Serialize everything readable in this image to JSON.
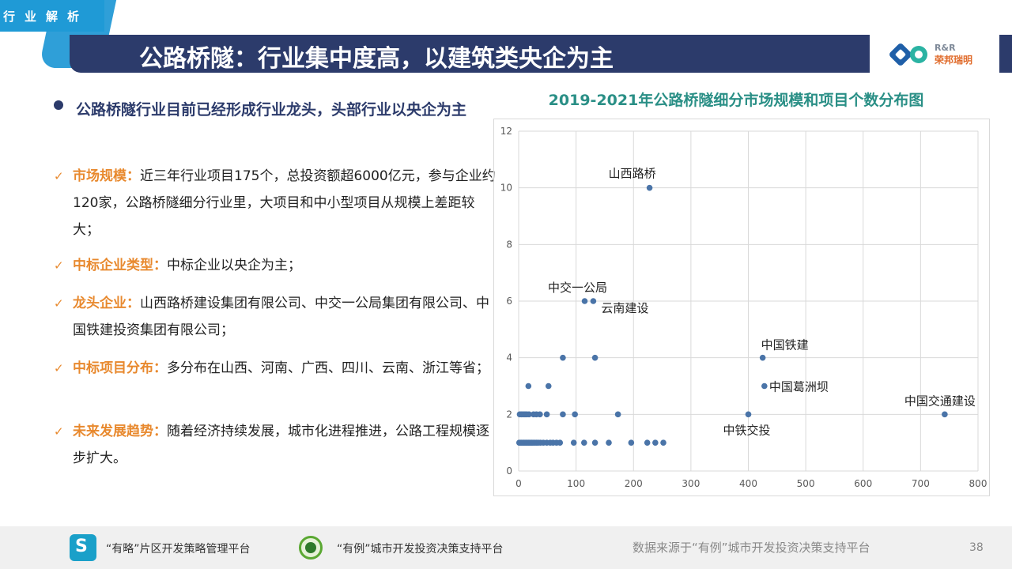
{
  "header": {
    "tag": "行业解析",
    "title": "公路桥隧：行业集中度高，以建筑类央企为主",
    "logo_line1": "R&R",
    "logo_line2": "荣邦瑞明"
  },
  "left": {
    "main_bullet": "公路桥隧行业目前已经形成行业龙头，头部行业以央企为主",
    "items": [
      {
        "label": "市场规模：",
        "text": "近三年行业项目175个，总投资额超6000亿元，参与企业约120家，公路桥隧细分行业里，大项目和中小型项目从规模上差距较大；"
      },
      {
        "label": "中标企业类型：",
        "text": "中标企业以央企为主；"
      },
      {
        "label": "龙头企业：",
        "text": "山西路桥建设集团有限公司、中交一公局集团有限公司、中国铁建投资集团有限公司；"
      },
      {
        "label": "中标项目分布：",
        "text": "多分布在山西、河南、广西、四川、云南、浙江等省；"
      },
      {
        "label": "未来发展趋势：",
        "text": "随着经济持续发展，城市化进程推进，公路工程规模逐步扩大。"
      }
    ]
  },
  "chart_data": {
    "type": "scatter",
    "title": "2019-2021年公路桥隧细分市场规模和项目个数分布图",
    "xlabel": "",
    "ylabel": "",
    "xlim": [
      0,
      800
    ],
    "ylim": [
      0,
      12
    ],
    "x_ticks": [
      0,
      100,
      200,
      300,
      400,
      500,
      600,
      700,
      800
    ],
    "y_ticks": [
      0,
      2,
      4,
      6,
      8,
      10,
      12
    ],
    "grid": true,
    "color": "#4a74a8",
    "points": [
      {
        "x": 228,
        "y": 10,
        "label": "山西路桥"
      },
      {
        "x": 115,
        "y": 6,
        "label": "中交一公局"
      },
      {
        "x": 130,
        "y": 6,
        "label": "云南建设"
      },
      {
        "x": 425,
        "y": 4,
        "label": "中国铁建"
      },
      {
        "x": 428,
        "y": 3,
        "label": "中国葛洲坝"
      },
      {
        "x": 400,
        "y": 2,
        "label": "中铁交投"
      },
      {
        "x": 742,
        "y": 2,
        "label": "中国交通建设"
      },
      {
        "x": 77,
        "y": 4
      },
      {
        "x": 133,
        "y": 4
      },
      {
        "x": 17,
        "y": 3
      },
      {
        "x": 52,
        "y": 3
      },
      {
        "x": 2,
        "y": 2
      },
      {
        "x": 5,
        "y": 2
      },
      {
        "x": 8,
        "y": 2
      },
      {
        "x": 11,
        "y": 2
      },
      {
        "x": 14,
        "y": 2
      },
      {
        "x": 18,
        "y": 2
      },
      {
        "x": 26,
        "y": 2
      },
      {
        "x": 31,
        "y": 2
      },
      {
        "x": 37,
        "y": 2
      },
      {
        "x": 49,
        "y": 2
      },
      {
        "x": 77,
        "y": 2
      },
      {
        "x": 98,
        "y": 2
      },
      {
        "x": 173,
        "y": 2
      },
      {
        "x": 1,
        "y": 1
      },
      {
        "x": 3,
        "y": 1
      },
      {
        "x": 5,
        "y": 1
      },
      {
        "x": 7,
        "y": 1
      },
      {
        "x": 9,
        "y": 1
      },
      {
        "x": 11,
        "y": 1
      },
      {
        "x": 13,
        "y": 1
      },
      {
        "x": 15,
        "y": 1
      },
      {
        "x": 17,
        "y": 1
      },
      {
        "x": 19,
        "y": 1
      },
      {
        "x": 21,
        "y": 1
      },
      {
        "x": 23,
        "y": 1
      },
      {
        "x": 25,
        "y": 1
      },
      {
        "x": 28,
        "y": 1
      },
      {
        "x": 31,
        "y": 1
      },
      {
        "x": 34,
        "y": 1
      },
      {
        "x": 38,
        "y": 1
      },
      {
        "x": 43,
        "y": 1
      },
      {
        "x": 49,
        "y": 1
      },
      {
        "x": 55,
        "y": 1
      },
      {
        "x": 60,
        "y": 1
      },
      {
        "x": 66,
        "y": 1
      },
      {
        "x": 72,
        "y": 1
      },
      {
        "x": 96,
        "y": 1
      },
      {
        "x": 114,
        "y": 1
      },
      {
        "x": 133,
        "y": 1
      },
      {
        "x": 157,
        "y": 1
      },
      {
        "x": 196,
        "y": 1
      },
      {
        "x": 224,
        "y": 1
      },
      {
        "x": 238,
        "y": 1
      },
      {
        "x": 252,
        "y": 1
      }
    ]
  },
  "footer": {
    "platform1_icon": "S",
    "platform1": "“有略”片区开发策略管理平台",
    "platform2": "“有例”城市开发投资决策支持平台",
    "source": "数据来源于“有例”城市开发投资决策支持平台",
    "page": "38"
  }
}
